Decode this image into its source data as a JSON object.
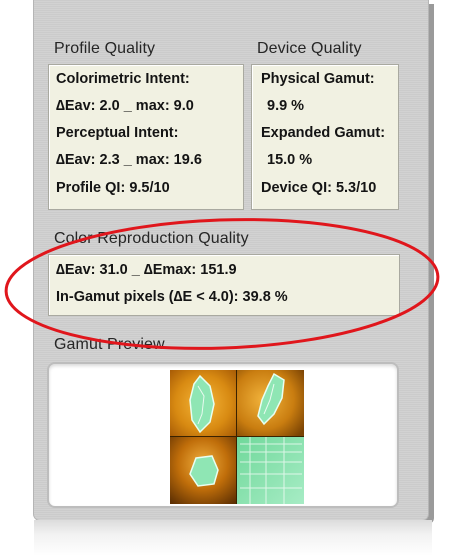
{
  "profile_quality": {
    "title": "Profile Quality",
    "lines": [
      "Colorimetric Intent:",
      "∆Eav: 2.0 _ max: 9.0",
      "Perceptual Intent:",
      "∆Eav: 2.3 _ max: 19.6",
      "Profile QI: 9.5/10"
    ]
  },
  "device_quality": {
    "title": "Device Quality",
    "lines": [
      "Physical Gamut:",
      "9.9 %",
      "Expanded Gamut:",
      "15.0 %",
      "Device QI: 5.3/10"
    ]
  },
  "color_reproduction": {
    "title": "Color Reproduction Quality",
    "line1": "∆Eav: 31.0  _  ∆Emax: 151.9",
    "line2": "In-Gamut pixels (∆E < 4.0): 39.8 %"
  },
  "gamut_preview": {
    "title": "Gamut Preview",
    "image_icon": "gamut-preview-image"
  },
  "colors": {
    "panel": "#cfcfcf",
    "box_fill": "#f1f1e2",
    "annotation_circle": "#e0161c",
    "gamut_orange": "#d68a14",
    "gamut_green": "#7fe0a8"
  }
}
